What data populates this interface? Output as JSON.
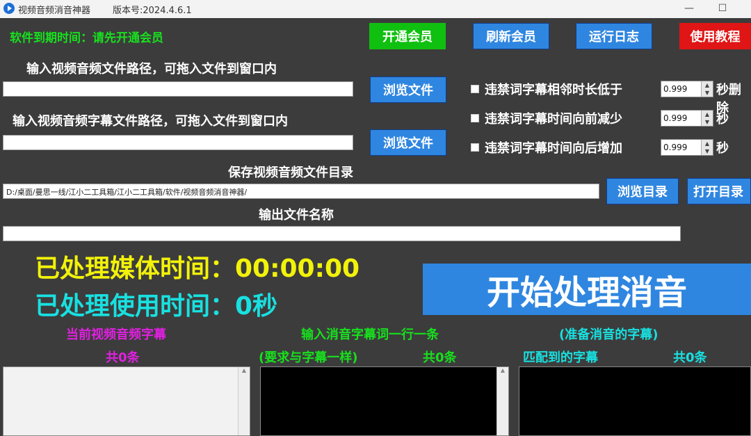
{
  "window": {
    "title": "视频音频消音神器",
    "version": "版本号:2024.4.6.1",
    "minimize": "—",
    "maximize": "☐"
  },
  "membership": {
    "expire_text": "软件到期时间：请先开通会员",
    "open_member": "开通会员",
    "refresh_member": "刷新会员",
    "run_log": "运行日志",
    "tutorial": "使用教程"
  },
  "media_input": {
    "label": "输入视频音频文件路径，可拖入文件到窗口内",
    "value": "",
    "browse": "浏览文件"
  },
  "subtitle_input": {
    "label": "输入视频音频字幕文件路径，可拖入文件到窗口内",
    "value": "",
    "browse": "浏览文件"
  },
  "save_dir": {
    "label": "保存视频音频文件目录",
    "value": "D:/桌面/曼思一线/江小二工具箱/江小二工具箱/软件/视频音频消音神器/",
    "browse": "浏览目录",
    "open": "打开目录"
  },
  "output_name": {
    "label": "输出文件名称",
    "value": ""
  },
  "options": [
    {
      "label": "违禁词字幕相邻时长低于",
      "value": "0.999",
      "suffix": "秒删除"
    },
    {
      "label": "违禁词字幕时间向前减少",
      "value": "0.999",
      "suffix": "秒"
    },
    {
      "label": "违禁词字幕时间向后增加",
      "value": "0.999",
      "suffix": "秒"
    }
  ],
  "status": {
    "media_time": "已处理媒体时间：00:00:00",
    "use_time": "已处理使用时间：0秒"
  },
  "start_button": "开始处理消音",
  "lists": {
    "current_subs_title": "当前视频音频字幕",
    "current_subs_count": "共0条",
    "input_words_title": "输入消音字幕词一行一条",
    "input_words_hint": "(要求与字幕一样)",
    "input_words_count": "共0条",
    "prepare_title": "(准备消音的字幕)",
    "matched_title": "匹配到的字幕",
    "matched_count": "共0条"
  },
  "colors": {
    "background": "#3c3c3c",
    "accent_blue": "#2f86e0",
    "green": "#10c010",
    "red": "#e01515",
    "yellow": "#f2f20a",
    "cyan": "#19e0e0",
    "magenta": "#e020e0"
  }
}
